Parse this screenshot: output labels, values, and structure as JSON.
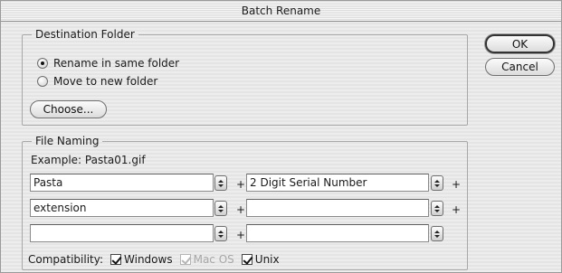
{
  "window": {
    "title": "Batch Rename"
  },
  "destination": {
    "legend": "Destination Folder",
    "rename_same": "Rename in same folder",
    "move_new": "Move to new folder",
    "selected": "rename_same",
    "choose_label": "Choose..."
  },
  "buttons": {
    "ok": "OK",
    "cancel": "Cancel"
  },
  "naming": {
    "legend": "File Naming",
    "example": "Example: Pasta01.gif",
    "plus": "+",
    "rows": [
      {
        "left": "Pasta",
        "right": "2 Digit Serial Number"
      },
      {
        "left": "extension",
        "right": ""
      },
      {
        "left": "",
        "right": ""
      }
    ]
  },
  "compatibility": {
    "label": "Compatibility:",
    "windows": {
      "label": "Windows",
      "checked": true,
      "enabled": true
    },
    "macos": {
      "label": "Mac OS",
      "checked": true,
      "enabled": false
    },
    "unix": {
      "label": "Unix",
      "checked": true,
      "enabled": true
    }
  }
}
